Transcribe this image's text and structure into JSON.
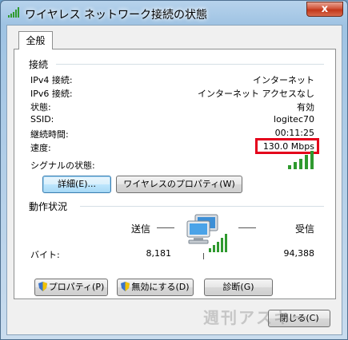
{
  "window": {
    "title": "ワイヤレス ネットワーク接続の状態",
    "close_label": "x"
  },
  "tabs": [
    {
      "label": "全般"
    }
  ],
  "connection": {
    "group_title": "接続",
    "rows": [
      {
        "label": "IPv4 接続:",
        "value": "インターネット"
      },
      {
        "label": "IPv6 接続:",
        "value": "インターネット アクセスなし"
      },
      {
        "label": "状態:",
        "value": "有効"
      },
      {
        "label": "SSID:",
        "value": "logitec70"
      },
      {
        "label": "継続時間:",
        "value": "00:11:25"
      },
      {
        "label": "速度:",
        "value": "130.0 Mbps"
      }
    ],
    "signal_label": "シグナルの状態:",
    "signal_level": {
      "bars_lit": 5,
      "bars_total": 5
    }
  },
  "buttons_top": {
    "details": "詳細(E)...",
    "wireless_properties": "ワイヤレスのプロパティ(W)"
  },
  "activity": {
    "group_title": "動作状況",
    "sent_label": "送信",
    "received_label": "受信",
    "bytes_label": "バイト:",
    "bytes_sent": "8,181",
    "bytes_received": "94,388"
  },
  "buttons_bottom": {
    "properties": "プロパティ(P)",
    "disable": "無効にする(D)",
    "diagnose": "診断(G)"
  },
  "footer": {
    "close": "閉じる(C)",
    "watermark": "週刊アスキー"
  },
  "colors": {
    "highlight_box": "#e4001b",
    "signal_green": "#2f9a2f",
    "title_gradient_top": "#b7d3ec"
  }
}
